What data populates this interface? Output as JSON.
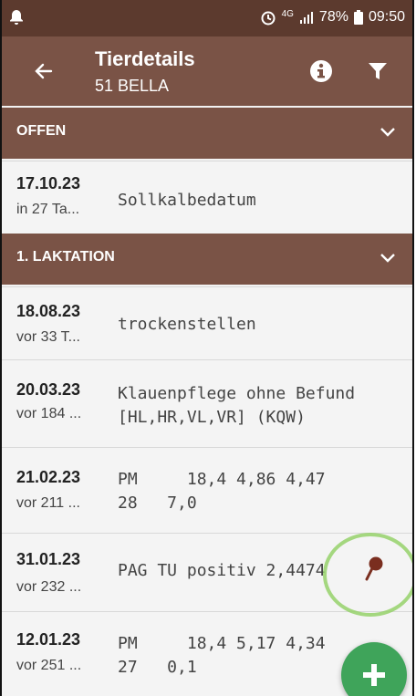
{
  "status_bar": {
    "network": "4G",
    "battery": "78%",
    "time": "09:50"
  },
  "app_bar": {
    "title": "Tierdetails",
    "subtitle": "51 BELLA"
  },
  "sections": [
    {
      "label": "OFFEN",
      "rows": [
        {
          "date": "17.10.23",
          "relative": "in 27 Ta...",
          "description": "Sollkalbedatum"
        }
      ]
    },
    {
      "label": "1. LAKTATION",
      "rows": [
        {
          "date": "18.08.23",
          "relative": "vor 33 T...",
          "description": "trockenstellen"
        },
        {
          "date": "20.03.23",
          "relative": "vor 184 ...",
          "description": "Klauenpflege ohne Befund\n[HL,HR,VL,VR] (KQW)"
        },
        {
          "date": "21.02.23",
          "relative": "vor 211 ...",
          "description": "PM     18,4 4,86 4,47\n28   7,0"
        },
        {
          "date": "31.01.23",
          "relative": "vor 232 ...",
          "description": "PAG TU positiv 2,4474"
        },
        {
          "date": "12.01.23",
          "relative": "vor 251 ...",
          "description": "PM     18,4 5,17 4,34\n27   0,1"
        }
      ]
    }
  ],
  "colors": {
    "status_bar": "#5c3a2e",
    "app_bar": "#7a5346",
    "fab": "#3fa45a",
    "highlight_circle": "#95d16a"
  },
  "icons": [
    "back-arrow-icon",
    "info-icon",
    "filter-icon",
    "chevron-down-icon",
    "pin-icon",
    "plus-icon"
  ]
}
